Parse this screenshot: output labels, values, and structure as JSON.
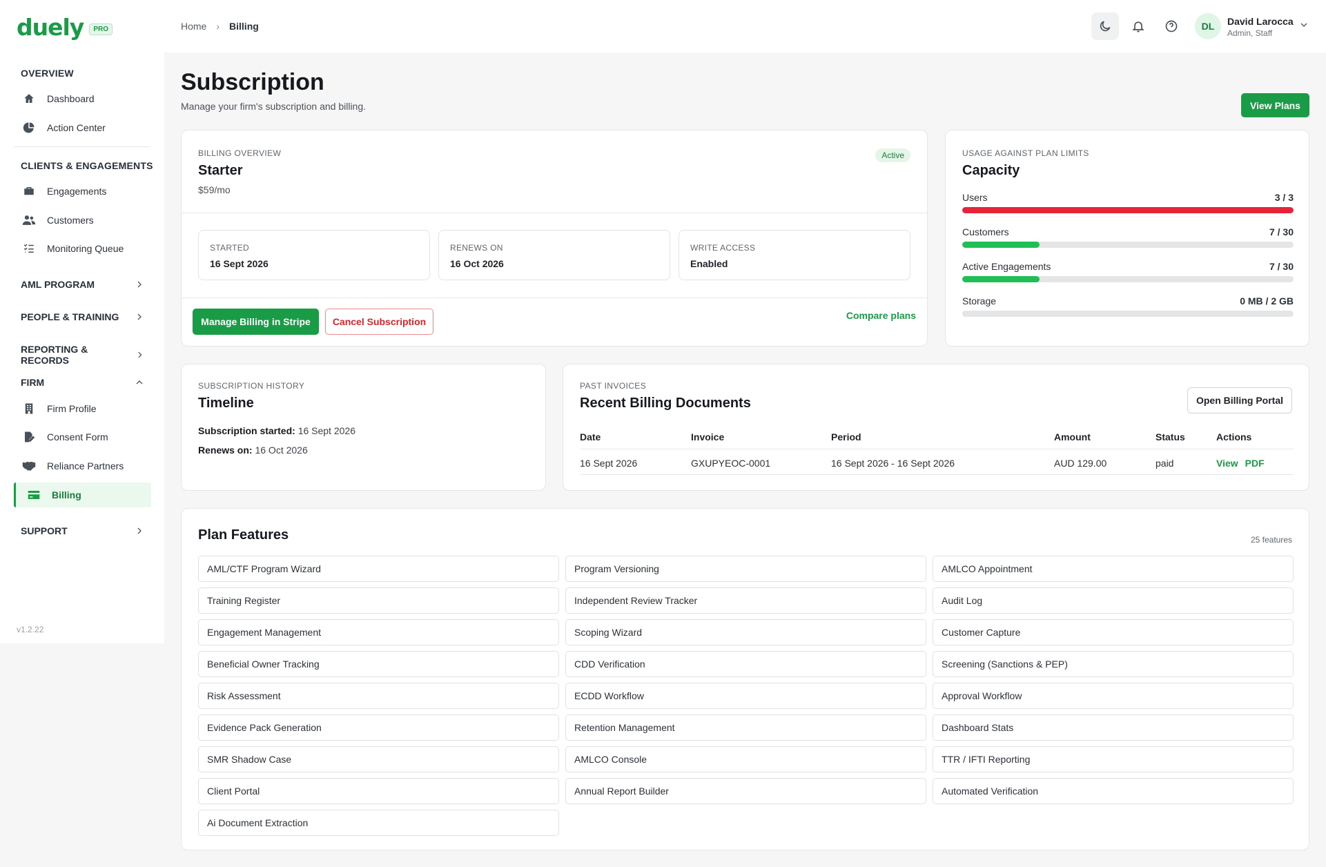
{
  "brand": {
    "name": "duely",
    "badge": "PRO"
  },
  "sidebar": {
    "sections": {
      "overview": "OVERVIEW",
      "clients": "CLIENTS & ENGAGEMENTS",
      "aml": "AML PROGRAM",
      "people": "PEOPLE & TRAINING",
      "reporting": "REPORTING & RECORDS",
      "firm": "FIRM",
      "support": "SUPPORT"
    },
    "items": {
      "dashboard": "Dashboard",
      "action_center": "Action Center",
      "engagements": "Engagements",
      "customers": "Customers",
      "monitoring": "Monitoring Queue",
      "firm_profile": "Firm Profile",
      "consent_form": "Consent Form",
      "reliance_partners": "Reliance Partners",
      "billing": "Billing"
    },
    "version": "v1.2.22"
  },
  "topbar": {
    "breadcrumb": {
      "home": "Home",
      "current": "Billing"
    },
    "user": {
      "initials": "DL",
      "name": "David Larocca",
      "role": "Admin, Staff"
    }
  },
  "page": {
    "title": "Subscription",
    "subtitle": "Manage your firm's subscription and billing.",
    "view_plans": "View Plans"
  },
  "billing": {
    "eyebrow": "BILLING OVERVIEW",
    "plan": "Starter",
    "price": "$59/mo",
    "status": "Active",
    "started_label": "STARTED",
    "started": "16 Sept 2026",
    "renews_label": "RENEWS ON",
    "renews": "16 Oct 2026",
    "write_label": "WRITE ACCESS",
    "write": "Enabled",
    "manage_btn": "Manage Billing in Stripe",
    "cancel_btn": "Cancel Subscription",
    "compare": "Compare plans"
  },
  "capacity": {
    "eyebrow": "USAGE AGAINST PLAN LIMITS",
    "title": "Capacity",
    "meters": [
      {
        "label": "Users",
        "value": "3 / 3",
        "fraction": 1.0,
        "color": "#e5243a"
      },
      {
        "label": "Customers",
        "value": "7 / 30",
        "fraction": 0.233,
        "color": "#1fbf55"
      },
      {
        "label": "Active Engagements",
        "value": "7 / 30",
        "fraction": 0.233,
        "color": "#1fbf55"
      },
      {
        "label": "Storage",
        "value": "0 MB / 2 GB",
        "fraction": 0,
        "color": "#1fbf55"
      }
    ]
  },
  "timeline": {
    "eyebrow": "SUBSCRIPTION HISTORY",
    "title": "Timeline",
    "started_label": "Subscription started:",
    "started": "16 Sept 2026",
    "renews_label": "Renews on:",
    "renews": "16 Oct 2026"
  },
  "invoices": {
    "eyebrow": "PAST INVOICES",
    "title": "Recent Billing Documents",
    "portal_btn": "Open Billing Portal",
    "columns": {
      "date": "Date",
      "invoice": "Invoice",
      "period": "Period",
      "amount": "Amount",
      "status": "Status",
      "actions": "Actions"
    },
    "rows": [
      {
        "date": "16 Sept 2026",
        "invoice": "GXUPYEOC-0001",
        "period": "16 Sept 2026 - 16 Sept 2026",
        "amount": "AUD 129.00",
        "status": "paid",
        "view": "View",
        "pdf": "PDF"
      }
    ]
  },
  "features": {
    "title": "Plan Features",
    "count": "25 features",
    "items": [
      "AML/CTF Program Wizard",
      "Program Versioning",
      "AMLCO Appointment",
      "Training Register",
      "Independent Review Tracker",
      "Audit Log",
      "Engagement Management",
      "Scoping Wizard",
      "Customer Capture",
      "Beneficial Owner Tracking",
      "CDD Verification",
      "Screening (Sanctions & PEP)",
      "Risk Assessment",
      "ECDD Workflow",
      "Approval Workflow",
      "Evidence Pack Generation",
      "Retention Management",
      "Dashboard Stats",
      "SMR Shadow Case",
      "AMLCO Console",
      "TTR / IFTI Reporting",
      "Client Portal",
      "Annual Report Builder",
      "Automated Verification",
      "Ai Document Extraction"
    ]
  }
}
